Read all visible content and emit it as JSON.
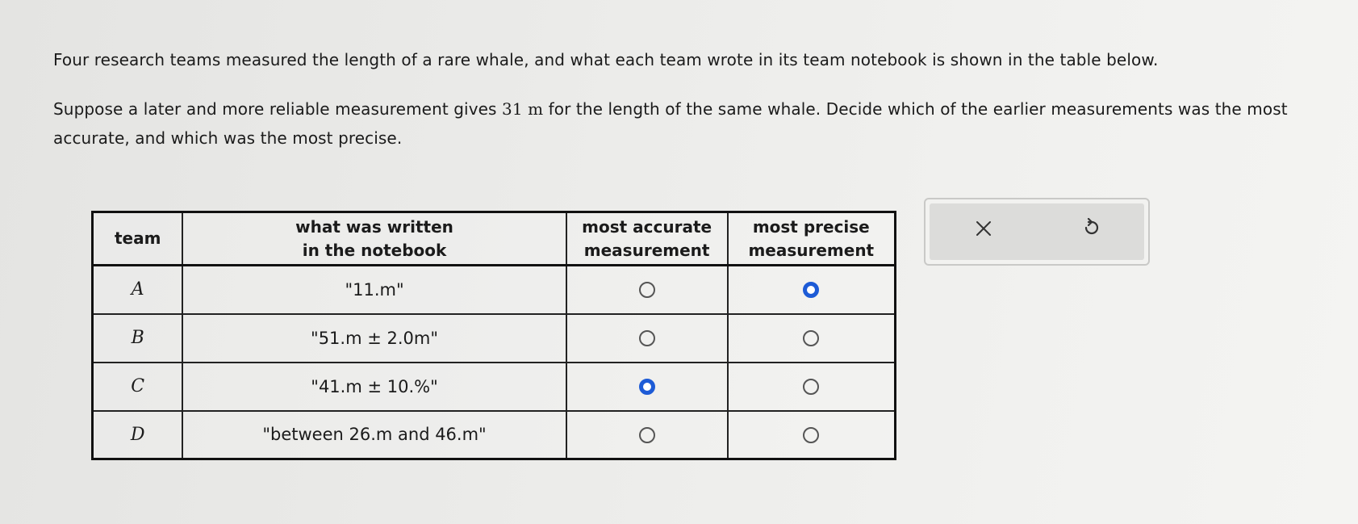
{
  "question": {
    "line1": "Four research teams measured the length of a rare whale, and what each team wrote in its team notebook is shown in the table below.",
    "line2_before": "Suppose a later and more reliable measurement gives ",
    "line2_value": "31 m",
    "line2_after": " for the length of the same whale. Decide which of the earlier measurements was the most accurate, and which was the most precise."
  },
  "table": {
    "headers": {
      "team": "team",
      "notebook_1": "what was written",
      "notebook_2": "in the notebook",
      "accurate_1": "most accurate",
      "accurate_2": "measurement",
      "precise_1": "most precise",
      "precise_2": "measurement"
    },
    "rows": [
      {
        "team": "A",
        "notebook": "\"11.m\"",
        "most_accurate_selected": false,
        "most_precise_selected": true
      },
      {
        "team": "B",
        "notebook": "\"51.m ± 2.0m\"",
        "most_accurate_selected": false,
        "most_precise_selected": false
      },
      {
        "team": "C",
        "notebook": "\"41.m ± 10.%\"",
        "most_accurate_selected": true,
        "most_precise_selected": false
      },
      {
        "team": "D",
        "notebook": "\"between 26.m and 46.m\"",
        "most_accurate_selected": false,
        "most_precise_selected": false
      }
    ]
  },
  "tools": {
    "clear_icon": "close-icon",
    "undo_icon": "undo-icon"
  },
  "colors": {
    "selected_radio": "#1d5bd6",
    "unselected_radio": "#555555",
    "tool_panel": "#dcdcda"
  }
}
